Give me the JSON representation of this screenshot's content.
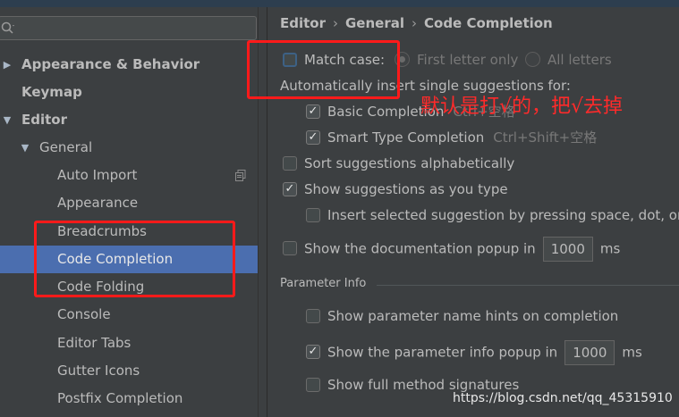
{
  "search": {
    "placeholder": ""
  },
  "tree": [
    {
      "label": "Appearance & Behavior",
      "arrow": "▶",
      "bold": true
    },
    {
      "label": "Keymap",
      "arrow": "",
      "bold": true
    },
    {
      "label": "Editor",
      "arrow": "▼",
      "bold": true
    },
    {
      "label": "General",
      "arrow": "▼",
      "bold": false
    },
    {
      "label": "Auto Import",
      "arrow": "",
      "bold": false
    },
    {
      "label": "Appearance",
      "arrow": "",
      "bold": false
    },
    {
      "label": "Breadcrumbs",
      "arrow": "",
      "bold": false
    },
    {
      "label": "Code Completion",
      "arrow": "",
      "bold": false,
      "selected": true
    },
    {
      "label": "Code Folding",
      "arrow": "",
      "bold": false
    },
    {
      "label": "Console",
      "arrow": "",
      "bold": false
    },
    {
      "label": "Editor Tabs",
      "arrow": "",
      "bold": false
    },
    {
      "label": "Gutter Icons",
      "arrow": "",
      "bold": false
    },
    {
      "label": "Postfix Completion",
      "arrow": "",
      "bold": false
    }
  ],
  "breadcrumb": {
    "part1": "Editor",
    "part2": "General",
    "part3": "Code Completion",
    "separator": "›"
  },
  "options": {
    "match_case": {
      "label": "Match case:",
      "checked": false
    },
    "first_letter": {
      "label": "First letter only",
      "selected": true
    },
    "all_letters": {
      "label": "All letters",
      "selected": false
    },
    "auto_insert_heading": "Automatically insert single suggestions for:",
    "basic_completion": {
      "label": "Basic Completion",
      "shortcut": "Ctrl+空格",
      "checked": true
    },
    "smart_type": {
      "label": "Smart Type Completion",
      "shortcut": "Ctrl+Shift+空格",
      "checked": true
    },
    "sort_alpha": {
      "label": "Sort suggestions alphabetically",
      "checked": false
    },
    "show_as_type": {
      "label": "Show suggestions as you type",
      "checked": true
    },
    "insert_selected": {
      "label": "Insert selected suggestion by pressing space, dot, or o",
      "checked": false
    },
    "doc_popup": {
      "label": "Show the documentation popup in",
      "value": "1000",
      "unit": "ms",
      "checked": false
    }
  },
  "parameter_info": {
    "title": "Parameter Info",
    "name_hints": {
      "label": "Show parameter name hints on completion",
      "checked": false
    },
    "info_popup": {
      "label": "Show the parameter info popup in",
      "value": "1000",
      "unit": "ms",
      "checked": true
    },
    "full_signatures": {
      "label": "Show full method signatures",
      "checked": false
    }
  },
  "annotation": {
    "text": "默认是打√的，把√去掉",
    "color": "#ff1a1a"
  },
  "watermark": "https://blog.csdn.net/qq_45315910",
  "colors": {
    "background": "#3c3f41",
    "selection": "#4b6eaf",
    "text": "#bbbbbb",
    "annotation": "#ff1a1a"
  },
  "icons": {
    "search": "search-icon",
    "copy": "copy-icon",
    "check": "✓"
  }
}
